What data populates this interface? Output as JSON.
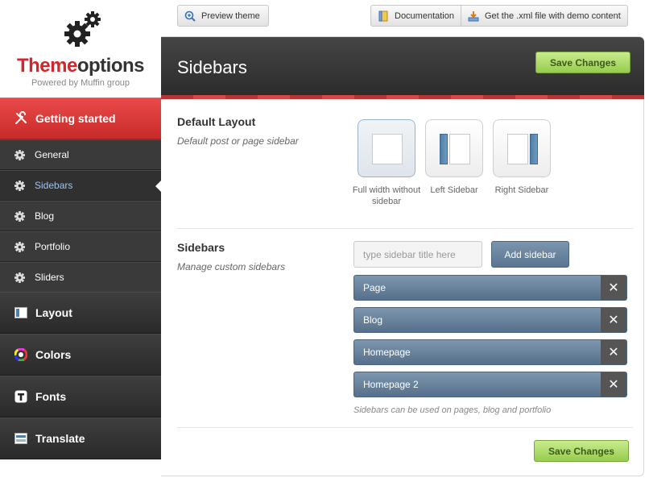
{
  "brand": {
    "part1": "Theme",
    "part2": "options",
    "subtitle": "Powered by Muffin group"
  },
  "nav": {
    "getting_started": "Getting started",
    "sub_items": [
      {
        "label": "General"
      },
      {
        "label": "Sidebars",
        "active": true
      },
      {
        "label": "Blog"
      },
      {
        "label": "Portfolio"
      },
      {
        "label": "Sliders"
      }
    ],
    "layout": "Layout",
    "colors": "Colors",
    "fonts": "Fonts",
    "translate": "Translate"
  },
  "toolbar": {
    "preview": "Preview theme",
    "documentation": "Documentation",
    "xml": "Get the .xml file with demo content"
  },
  "panel": {
    "title": "Sidebars",
    "save_label": "Save Changes",
    "default_layout": {
      "title": "Default Layout",
      "desc": "Default post or page sidebar",
      "options": [
        {
          "label": "Full width without sidebar",
          "selected": true
        },
        {
          "label": "Left Sidebar"
        },
        {
          "label": "Right Sidebar"
        }
      ]
    },
    "sidebars": {
      "title": "Sidebars",
      "desc": "Manage custom sidebars",
      "input_placeholder": "type sidebar title here",
      "add_label": "Add sidebar",
      "items": [
        "Page",
        "Blog",
        "Homepage",
        "Homepage 2"
      ],
      "remove_glyph": "✕",
      "note": "Sidebars can be used on pages, blog and portfolio"
    }
  },
  "colors": {
    "accent_red": "#d0262c",
    "save_green": "#96cc4e",
    "item_blue": "#56708b"
  }
}
